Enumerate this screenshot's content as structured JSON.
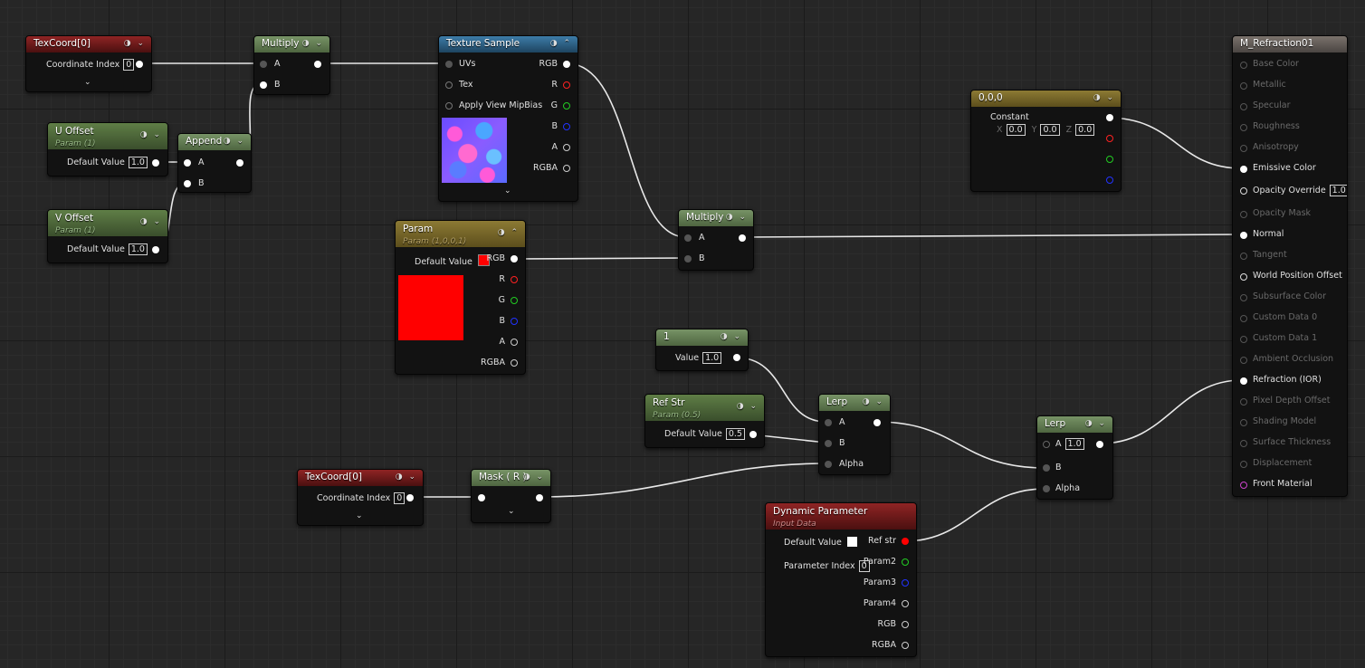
{
  "colors": {
    "rgb": "#ffffff",
    "r": "#ff2222",
    "g": "#22cc22",
    "b": "#2233ff",
    "front": "#cc44cc",
    "param_red": "#ff0000"
  },
  "nodes": {
    "texcoord1": {
      "title": "TexCoord[0]",
      "coord_label": "Coordinate Index",
      "coord_value": "0"
    },
    "multiply1": {
      "title": "Multiply",
      "a": "A",
      "b": "B"
    },
    "texsample": {
      "title": "Texture Sample",
      "uvs": "UVs",
      "tex": "Tex",
      "mip": "Apply View MipBias",
      "rgb": "RGB",
      "r": "R",
      "g": "G",
      "b": "B",
      "a": "A",
      "rgba": "RGBA"
    },
    "uoffset": {
      "title": "U Offset",
      "subtitle": "Param (1)",
      "label": "Default Value",
      "value": "1.0"
    },
    "voffset": {
      "title": "V Offset",
      "subtitle": "Param (1)",
      "label": "Default Value",
      "value": "1.0"
    },
    "append": {
      "title": "Append",
      "a": "A",
      "b": "B"
    },
    "param": {
      "title": "Param",
      "subtitle": "Param (1,0,0,1)",
      "label": "Default Value",
      "rgb": "RGB",
      "r": "R",
      "g": "G",
      "b": "B",
      "a": "A",
      "rgba": "RGBA"
    },
    "multiply2": {
      "title": "Multiply",
      "a": "A",
      "b": "B"
    },
    "constant3": {
      "title": "0,0,0",
      "label": "Constant",
      "x_label": "X",
      "x": "0.0",
      "y_label": "Y",
      "y": "0.0",
      "z_label": "Z",
      "z": "0.0"
    },
    "one": {
      "title": "1",
      "label": "Value",
      "value": "1.0"
    },
    "refstr": {
      "title": "Ref Str",
      "subtitle": "Param (0.5)",
      "label": "Default Value",
      "value": "0.5"
    },
    "lerp1": {
      "title": "Lerp",
      "a": "A",
      "b": "B",
      "alpha": "Alpha"
    },
    "texcoord2": {
      "title": "TexCoord[0]",
      "coord_label": "Coordinate Index",
      "coord_value": "0"
    },
    "mask": {
      "title": "Mask ( R )"
    },
    "lerp2": {
      "title": "Lerp",
      "a": "A",
      "a_value": "1.0",
      "b": "B",
      "alpha": "Alpha"
    },
    "dynparam": {
      "title": "Dynamic Parameter",
      "subtitle": "Input Data",
      "label": "Default Value",
      "index_label": "Parameter Index",
      "index_value": "0",
      "refstr": "Ref str",
      "p2": "Param2",
      "p3": "Param3",
      "p4": "Param4",
      "rgb": "RGB",
      "rgba": "RGBA"
    },
    "material": {
      "title": "M_Refraction01",
      "base_color": "Base Color",
      "metallic": "Metallic",
      "specular": "Specular",
      "roughness": "Roughness",
      "anisotropy": "Anisotropy",
      "emissive": "Emissive Color",
      "opacity_override": "Opacity Override",
      "opacity_value": "1.0",
      "opacity_mask": "Opacity Mask",
      "normal": "Normal",
      "tangent": "Tangent",
      "wpo": "World Position Offset",
      "subsurface": "Subsurface Color",
      "custom0": "Custom Data 0",
      "custom1": "Custom Data 1",
      "ao": "Ambient Occlusion",
      "refraction": "Refraction (IOR)",
      "pdo": "Pixel Depth Offset",
      "shading": "Shading Model",
      "thickness": "Surface Thickness",
      "displacement": "Displacement",
      "front": "Front Material"
    }
  }
}
